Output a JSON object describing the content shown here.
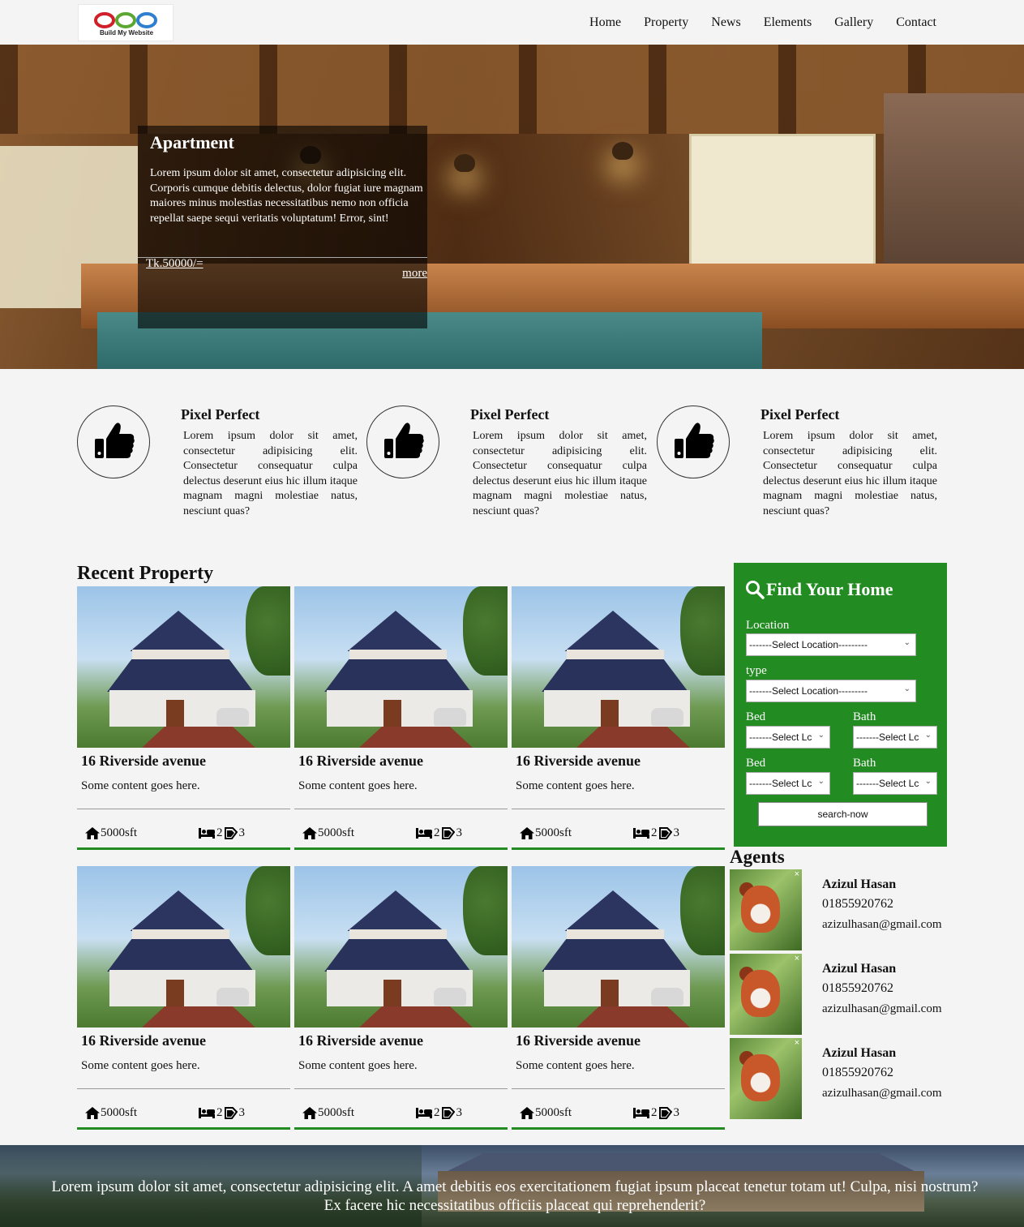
{
  "header": {
    "logo_text": "Build My Website",
    "nav": [
      "Home",
      "Property",
      "News",
      "Elements",
      "Gallery",
      "Contact"
    ]
  },
  "hero": {
    "title": "Apartment",
    "text": "Lorem ipsum dolor sit amet, consectetur adipisicing elit. Corporis cumque debitis delectus, dolor fugiat iure magnam maiores minus molestias necessitatibus nemo non officia repellat saepe sequi veritatis voluptatum! Error, sint!",
    "price": "Tk.50000/=",
    "more": "more"
  },
  "features": [
    {
      "title": "Pixel Perfect",
      "text": "Lorem ipsum dolor sit amet, consectetur adipisicing elit. Consectetur consequatur culpa delectus deserunt eius hic illum itaque magnam magni molestiae natus, nesciunt quas?",
      "icon": "thumbs-up-icon"
    },
    {
      "title": "Pixel Perfect",
      "text": "Lorem ipsum dolor sit amet, consectetur adipisicing elit. Consectetur consequatur culpa delectus deserunt eius hic illum itaque magnam magni molestiae natus, nesciunt quas?",
      "icon": "thumbs-up-icon"
    },
    {
      "title": "Pixel Perfect",
      "text": "Lorem ipsum dolor sit amet, consectetur adipisicing elit. Consectetur consequatur culpa delectus deserunt eius hic illum itaque magnam magni molestiae natus, nesciunt quas?",
      "icon": "thumbs-up-icon"
    }
  ],
  "recent": {
    "title": "Recent Property",
    "cards": [
      {
        "title": "16 Riverside avenue",
        "desc": "Some content goes here.",
        "area": "5000sft",
        "beds": "2",
        "baths": "3"
      },
      {
        "title": "16 Riverside avenue",
        "desc": "Some content goes here.",
        "area": "5000sft",
        "beds": "2",
        "baths": "3"
      },
      {
        "title": "16 Riverside avenue",
        "desc": "Some content goes here.",
        "area": "5000sft",
        "beds": "2",
        "baths": "3"
      },
      {
        "title": "16 Riverside avenue",
        "desc": "Some content goes here.",
        "area": "5000sft",
        "beds": "2",
        "baths": "3"
      },
      {
        "title": "16 Riverside avenue",
        "desc": "Some content goes here.",
        "area": "5000sft",
        "beds": "2",
        "baths": "3"
      },
      {
        "title": "16 Riverside avenue",
        "desc": "Some content goes here.",
        "area": "5000sft",
        "beds": "2",
        "baths": "3"
      }
    ]
  },
  "search": {
    "title": "Find Your Home",
    "location_label": "Location",
    "location_value": "-------Select Location---------",
    "type_label": "type",
    "type_value": "-------Select Location---------",
    "bed_label": "Bed",
    "bath_label": "Bath",
    "short_value": "-------Select Lc",
    "button": "search-now",
    "accent": "#228b22"
  },
  "agents": {
    "title": "Agents",
    "list": [
      {
        "name": "Azizul Hasan",
        "phone": "01855920762",
        "email": "azizulhasan@gmail.com"
      },
      {
        "name": "Azizul Hasan",
        "phone": "01855920762",
        "email": "azizulhasan@gmail.com"
      },
      {
        "name": "Azizul Hasan",
        "phone": "01855920762",
        "email": "azizulhasan@gmail.com"
      }
    ]
  },
  "banner": {
    "text": "Lorem ipsum dolor sit amet, consectetur adipisicing elit. A amet debitis eos exercitationem fugiat ipsum placeat tenetur totam ut! Culpa, nisi nostrum? Ex facere hic necessitatibus officiis placeat qui reprehenderit?"
  }
}
